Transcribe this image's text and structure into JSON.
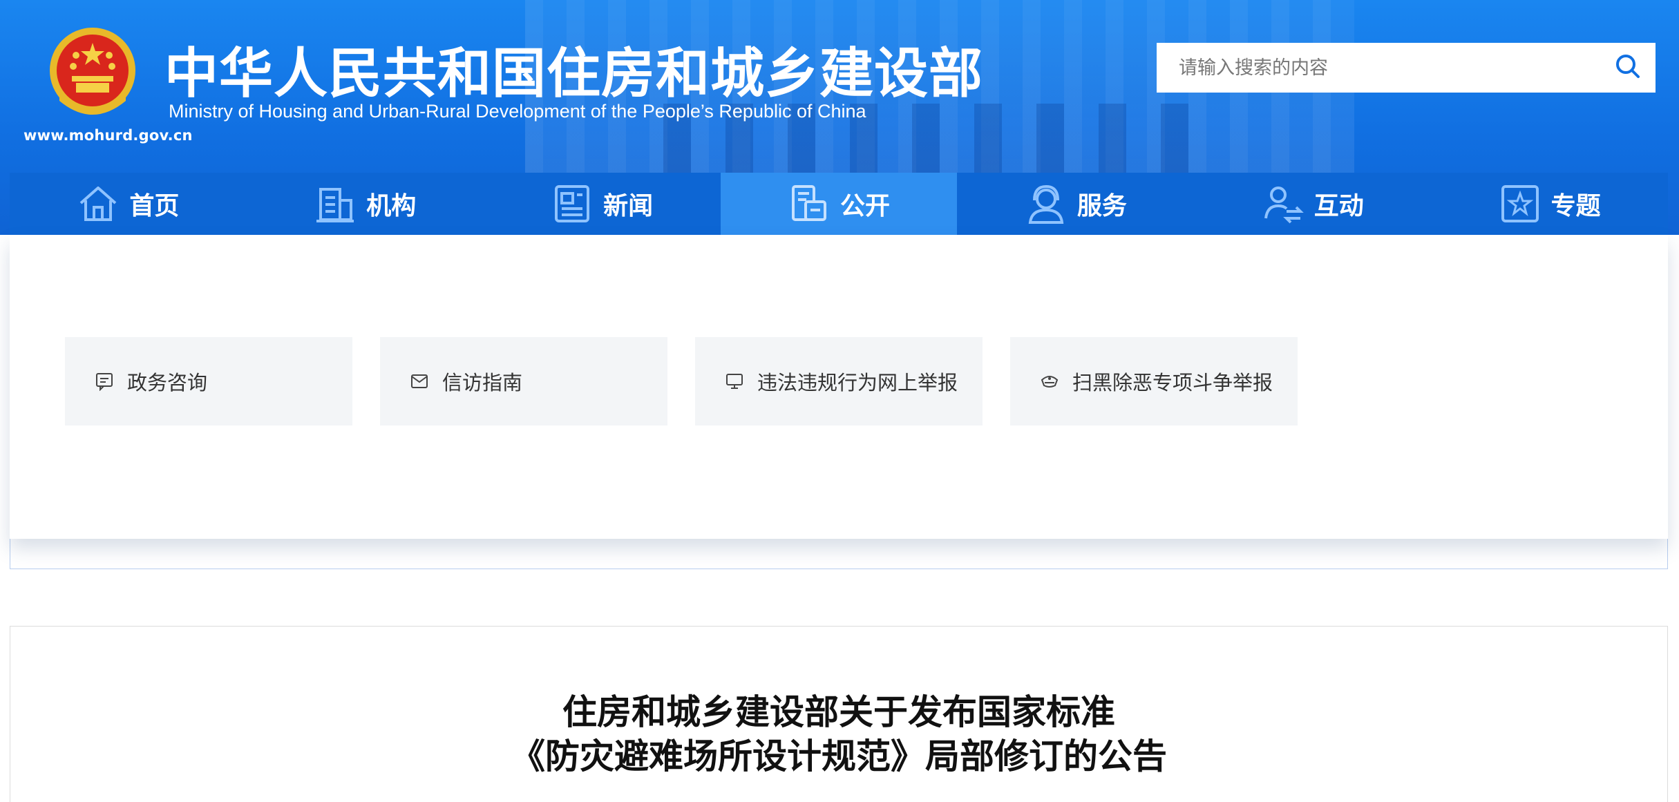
{
  "header": {
    "title_cn": "中华人民共和国住房和城乡建设部",
    "title_en": "Ministry of Housing and Urban-Rural Development of the People’s Republic of China",
    "site_url": "www.mohurd.gov.cn",
    "emblem_icon": "national-emblem-icon"
  },
  "search": {
    "placeholder": "请输入搜索的内容",
    "button_icon": "search-icon"
  },
  "nav": {
    "items": [
      {
        "label": "首页",
        "icon": "home-icon",
        "active": false
      },
      {
        "label": "机构",
        "icon": "building-icon",
        "active": false
      },
      {
        "label": "新闻",
        "icon": "news-icon",
        "active": false
      },
      {
        "label": "公开",
        "icon": "public-info-icon",
        "active": true
      },
      {
        "label": "服务",
        "icon": "customer-service-icon",
        "active": false
      },
      {
        "label": "互动",
        "icon": "interaction-icon",
        "active": false
      },
      {
        "label": "专题",
        "icon": "star-topic-icon",
        "active": false
      }
    ]
  },
  "services": [
    {
      "label": "政务咨询",
      "icon": "message-icon"
    },
    {
      "label": "信访指南",
      "icon": "mail-icon"
    },
    {
      "label": "违法违规行为网上举报",
      "icon": "monitor-icon"
    },
    {
      "label": "扫黑除恶专项斗争举报",
      "icon": "police-cap-icon"
    }
  ],
  "article": {
    "title_line1": "住房和城乡建设部关于发布国家标准",
    "title_line2": "《防灾避难场所设计规范》局部修订的公告"
  },
  "colors": {
    "header_blue": "#1170e2",
    "nav_blue": "#0d66d4",
    "nav_active": "#2f8ff0",
    "card_bg": "#f3f5f7"
  }
}
